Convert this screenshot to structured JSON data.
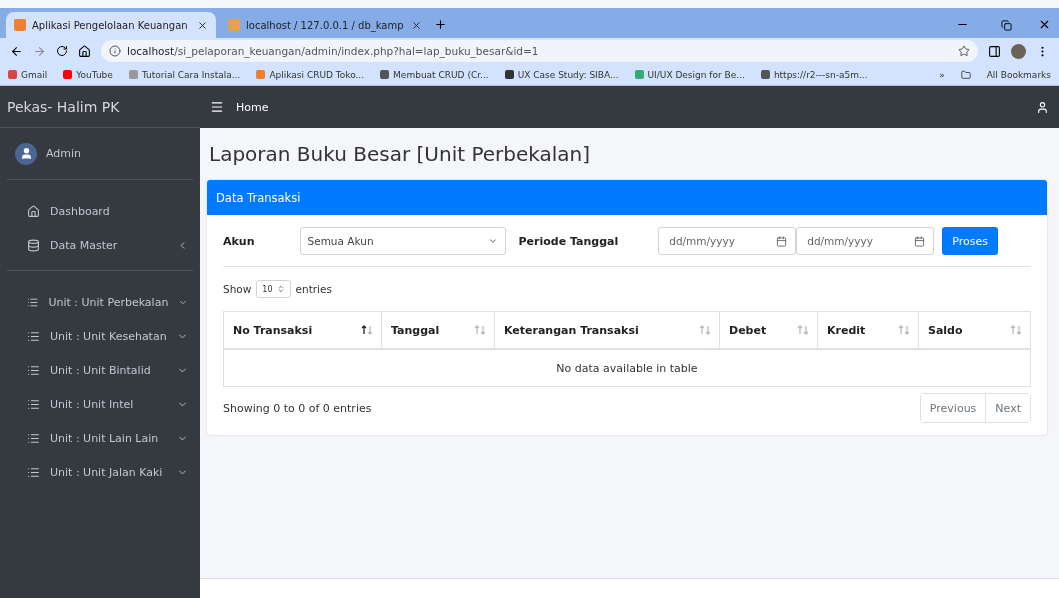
{
  "browser": {
    "tabs": [
      {
        "label": "Aplikasi Pengelolaan Keuangan",
        "selected": true
      },
      {
        "label": "localhost / 127.0.0.1 / db_kamp",
        "selected": false
      }
    ],
    "address": {
      "host": "localhost",
      "path": "/si_pelaporan_keuangan/admin/index.php?hal=lap_buku_besar&id=1"
    },
    "bookmarks": [
      "Gmail",
      "YouTube",
      "Tutorial Cara Instala...",
      "Aplikasi CRUD Toko...",
      "Membuat CRUD (Cr...",
      "UX Case Study: SIBA...",
      "UI/UX Design for Be...",
      "https://r2---sn-a5m..."
    ],
    "more_bookmarks": "»",
    "all_bookmarks": "All Bookmarks"
  },
  "sidebar": {
    "brand": "Pekas- Halim PK",
    "user": "Admin",
    "menu": [
      {
        "label": "Dashboard",
        "kind": "link"
      },
      {
        "label": "Data Master",
        "kind": "folder"
      }
    ],
    "units": [
      "Unit : Unit Perbekalan",
      "Unit : Unit Kesehatan",
      "Unit : Unit Bintalid",
      "Unit : Unit Intel",
      "Unit : Unit Lain Lain",
      "Unit : Unit Jalan Kaki"
    ]
  },
  "header": {
    "home": "Home"
  },
  "page_title": "Laporan Buku Besar [Unit Perbekalan]",
  "card": {
    "title": "Data Transaksi",
    "filter": {
      "account_label": "Akun",
      "account_value": "Semua Akun",
      "period_label": "Periode Tanggal",
      "date_from_placeholder": "dd/mm/yyyy",
      "date_to_placeholder": "dd/mm/yyyy",
      "button": "Proses"
    },
    "length": {
      "show": "Show",
      "value": "10",
      "entries": "entries"
    },
    "table": {
      "columns": [
        {
          "label": "No Transaksi",
          "sorted": true
        },
        {
          "label": "Tanggal",
          "sorted": false
        },
        {
          "label": "Keterangan Transaksi",
          "sorted": false
        },
        {
          "label": "Debet",
          "sorted": false
        },
        {
          "label": "Kredit",
          "sorted": false
        },
        {
          "label": "Saldo",
          "sorted": false
        }
      ],
      "empty": "No data available in table"
    },
    "info": "Showing 0 to 0 of 0 entries",
    "pagination": [
      "Previous",
      "Next"
    ]
  }
}
